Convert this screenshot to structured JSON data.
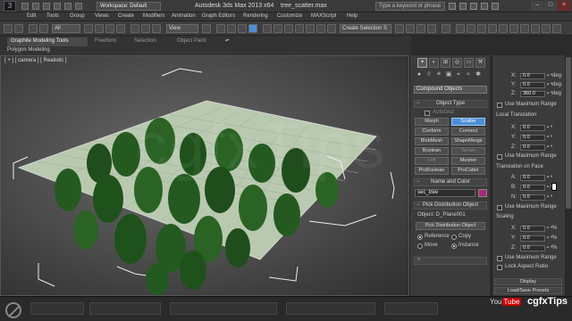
{
  "titlebar": {
    "workspace": "Workspace: Default",
    "app_title": "Autodesk 3ds Max  2013 x64",
    "file_title": "tree_scatter.max",
    "search_placeholder": "Type a keyword or phrase"
  },
  "menu": [
    "Edit",
    "Tools",
    "Group",
    "Views",
    "Create",
    "Modifiers",
    "Animation",
    "Graph Editors",
    "Rendering",
    "Customize",
    "MAXScript",
    "Help"
  ],
  "toolbar": {
    "filter": "All",
    "coord": "View",
    "selection_set": "Create Selection S"
  },
  "ribbon": {
    "tabs": [
      "Graphite Modeling Tools",
      "Freeform",
      "Selection",
      "Object Paint"
    ],
    "sub": "Polygon Modeling"
  },
  "viewport": {
    "label": "[ + ] [ camera ] [ Realistic ]",
    "watermark": "cgfxTips"
  },
  "command_panel": {
    "category": "Compound Objects",
    "object_type": {
      "title": "Object Type",
      "autogrid": "AutoGrid",
      "buttons": [
        "Morph",
        "Scatter",
        "Conform",
        "Connect",
        "BlobMesh",
        "ShapeMerge",
        "Boolean",
        "Terrain",
        "Loft",
        "Mesher",
        "ProBoolean",
        "ProCutter"
      ]
    },
    "name_color": {
      "title": "Name and Color",
      "name": "sec_tree"
    },
    "pick": {
      "title": "Pick Distribution Object",
      "object": "Object: D_Plane001",
      "button": "Pick Distribution Object",
      "reference": "Reference",
      "copy": "Copy",
      "move": "Move",
      "instance": "Instance"
    }
  },
  "params": {
    "rotation": {
      "x": "0.0",
      "y": "0.0",
      "z": "360.0",
      "unit": "deg",
      "use_max": "Use Maximum Range"
    },
    "local_translation": {
      "title": "Local Translation",
      "x": "0.0",
      "y": "0.0",
      "z": "0.0",
      "use_max": "Use Maximum Range"
    },
    "translation_face": {
      "title": "Translation on Face",
      "a": "0.0",
      "b": "0.0",
      "n": "0.0",
      "use_max": "Use Maximum Range"
    },
    "scaling": {
      "title": "Scaling",
      "x": "0.0",
      "y": "0.0",
      "z": "0.0",
      "unit": "%",
      "use_max": "Use Maximum Range",
      "lock": "Lock Aspect Ratio"
    },
    "display": "Display",
    "load_save": "Load/Save Presets"
  },
  "overlay": {
    "youtube": "You",
    "youtube_b": "Tube",
    "channel": "cgfxTips"
  }
}
